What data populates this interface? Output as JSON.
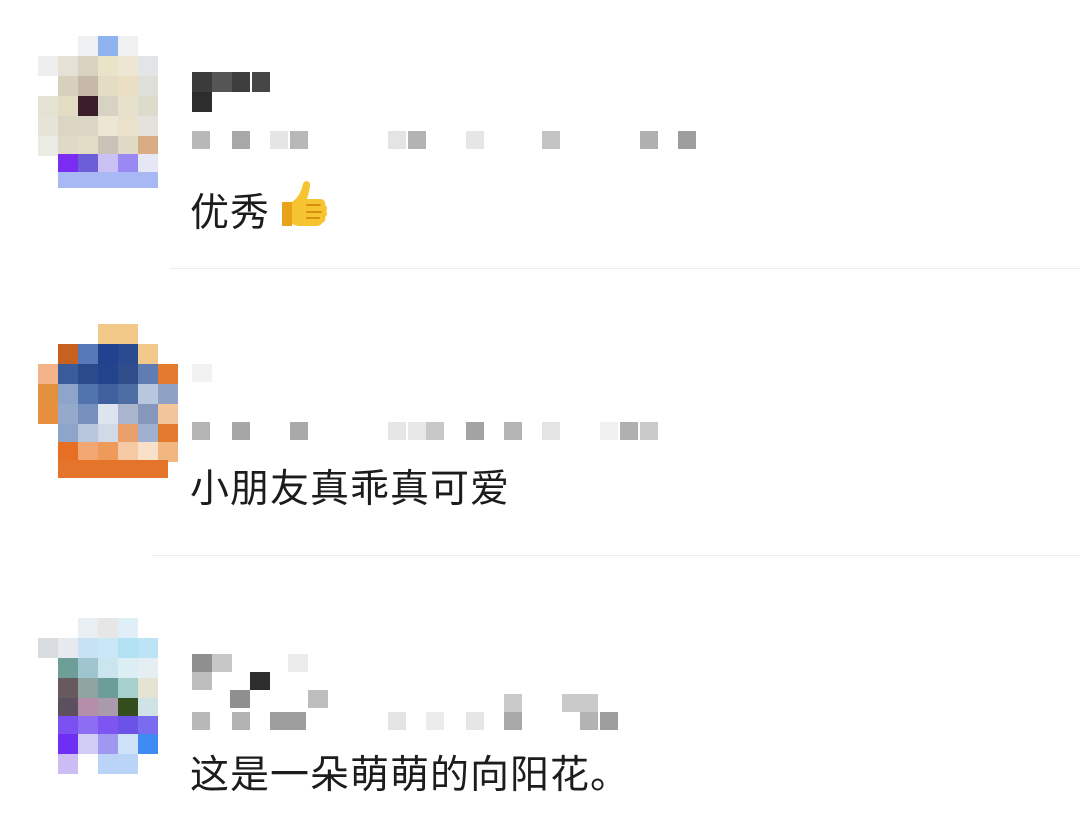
{
  "comments": [
    {
      "text": "优秀",
      "emoji_icon": "thumbs-up-icon"
    },
    {
      "text": "小朋友真乖真可爱"
    },
    {
      "text": "这是一朵萌萌的向阳花。"
    }
  ]
}
